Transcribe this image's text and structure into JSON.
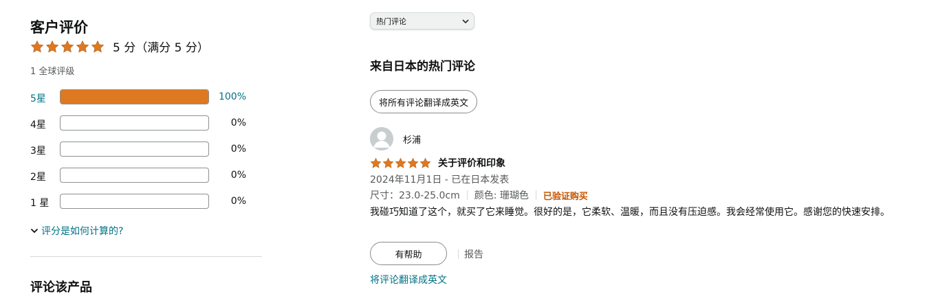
{
  "summary": {
    "title": "客户评价",
    "rating_value": 5,
    "rating_text": "5 分（满分 5 分）",
    "global_count": "1 全球评级",
    "histogram": [
      {
        "label": "5星",
        "percent_text": "100%",
        "fraction": 1.0
      },
      {
        "label": "4星",
        "percent_text": "0%",
        "fraction": 0
      },
      {
        "label": "3星",
        "percent_text": "0%",
        "fraction": 0
      },
      {
        "label": "2星",
        "percent_text": "0%",
        "fraction": 0
      },
      {
        "label": "1 星",
        "percent_text": "0%",
        "fraction": 0
      }
    ],
    "how_calculated": "评分是如何计算的?",
    "review_product_title": "评论该产品"
  },
  "reviews_panel": {
    "sort_selected": "热门评论",
    "section_title": "来自日本的热门评论",
    "translate_all": "将所有评论翻译成英文"
  },
  "review": {
    "reviewer": "杉浦",
    "rating_value": 5,
    "headline": "关于评价和印象",
    "date": "2024年11月1日 - 已在日本发表",
    "size": "尺寸：23.0-25.0cm",
    "color": "颜色: 珊瑚色",
    "verified": "已验证购买",
    "body": "我碰巧知道了这个，就买了它来睡觉。很好的是，它柔软、温暖，而且没有压迫感。我会经常使用它。感谢您的快速安排。",
    "helpful": "有帮助",
    "report": "报告",
    "translate": "将评论翻译成英文"
  },
  "colors": {
    "star": "#de7921",
    "link": "#007185",
    "verified": "#c45500"
  }
}
